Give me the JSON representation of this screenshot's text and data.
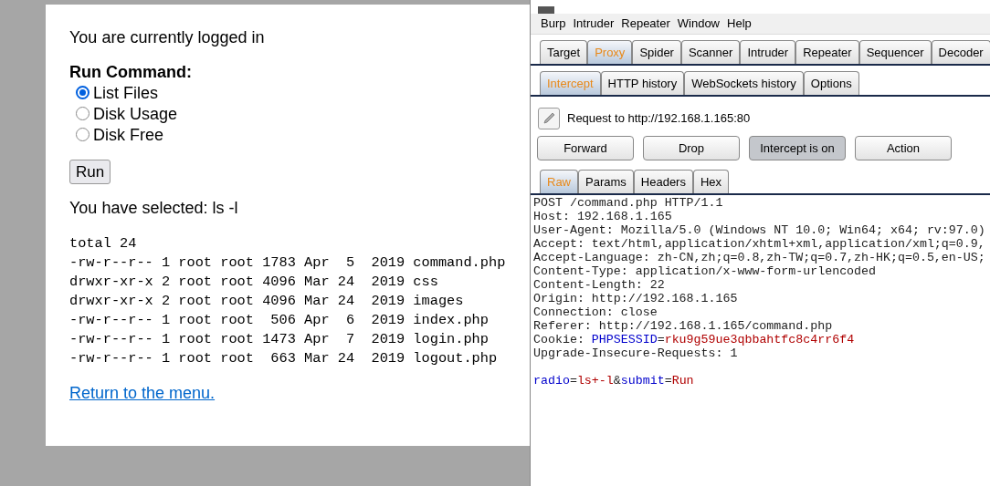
{
  "web_page": {
    "login_status": "You are currently logged in",
    "form_label": "Run Command:",
    "options": [
      {
        "label": "List Files",
        "checked": true
      },
      {
        "label": "Disk Usage",
        "checked": false
      },
      {
        "label": "Disk Free",
        "checked": false
      }
    ],
    "run_button": "Run",
    "selection": "You have selected: ls -l",
    "output_lines": [
      "total 24",
      "-rw-r--r-- 1 root root 1783 Apr  5  2019 command.php",
      "drwxr-xr-x 2 root root 4096 Mar 24  2019 css",
      "drwxr-xr-x 2 root root 4096 Mar 24  2019 images",
      "-rw-r--r-- 1 root root  506 Apr  6  2019 index.php",
      "-rw-r--r-- 1 root root 1473 Apr  7  2019 login.php",
      "-rw-r--r-- 1 root root  663 Mar 24  2019 logout.php"
    ],
    "return_link": "Return to the menu."
  },
  "burp": {
    "menu": [
      "Burp",
      "Intruder",
      "Repeater",
      "Window",
      "Help"
    ],
    "tabs": [
      {
        "label": "Target",
        "selected": false
      },
      {
        "label": "Proxy",
        "selected": true
      },
      {
        "label": "Spider",
        "selected": false
      },
      {
        "label": "Scanner",
        "selected": false
      },
      {
        "label": "Intruder",
        "selected": false
      },
      {
        "label": "Repeater",
        "selected": false
      },
      {
        "label": "Sequencer",
        "selected": false
      },
      {
        "label": "Decoder",
        "selected": false
      }
    ],
    "sub_tabs": [
      {
        "label": "Intercept",
        "selected": true
      },
      {
        "label": "HTTP history",
        "selected": false
      },
      {
        "label": "WebSockets history",
        "selected": false
      },
      {
        "label": "Options",
        "selected": false
      }
    ],
    "request_target": "Request to http://192.168.1.165:80",
    "buttons": [
      {
        "label": "Forward",
        "pressed": false
      },
      {
        "label": "Drop",
        "pressed": false
      },
      {
        "label": "Intercept is on",
        "pressed": true
      },
      {
        "label": "Action",
        "pressed": false
      }
    ],
    "view_tabs": [
      {
        "label": "Raw",
        "selected": true
      },
      {
        "label": "Params",
        "selected": false
      },
      {
        "label": "Headers",
        "selected": false
      },
      {
        "label": "Hex",
        "selected": false
      }
    ],
    "header_lines": [
      [
        {
          "text": "POST /command.php HTTP/1.1",
          "kind": "plain"
        }
      ],
      [
        {
          "text": "Host: 192.168.1.165",
          "kind": "plain"
        }
      ],
      [
        {
          "text": "User-Agent: Mozilla/5.0 (Windows NT 10.0; Win64; x64; rv:97.0)",
          "kind": "plain"
        }
      ],
      [
        {
          "text": "Accept: text/html,application/xhtml+xml,application/xml;q=0.9,",
          "kind": "plain"
        }
      ],
      [
        {
          "text": "Accept-Language: zh-CN,zh;q=0.8,zh-TW;q=0.7,zh-HK;q=0.5,en-US;",
          "kind": "plain"
        }
      ],
      [
        {
          "text": "Content-Type: application/x-www-form-urlencoded",
          "kind": "plain"
        }
      ],
      [
        {
          "text": "Content-Length: 22",
          "kind": "plain"
        }
      ],
      [
        {
          "text": "Origin: http://192.168.1.165",
          "kind": "plain"
        }
      ],
      [
        {
          "text": "Connection: close",
          "kind": "plain"
        }
      ],
      [
        {
          "text": "Referer: http://192.168.1.165/command.php",
          "kind": "plain"
        }
      ],
      [
        {
          "text": "Cookie: ",
          "kind": "plain"
        },
        {
          "text": "PHPSESSID",
          "kind": "name"
        },
        {
          "text": "=",
          "kind": "plain"
        },
        {
          "text": "rku9g59ue3qbbahtfc8c4rr6f4",
          "kind": "value"
        }
      ],
      [
        {
          "text": "Upgrade-Insecure-Requests: 1",
          "kind": "plain"
        }
      ]
    ],
    "body_lines": [
      [
        {
          "text": "radio",
          "kind": "name"
        },
        {
          "text": "=",
          "kind": "plain"
        },
        {
          "text": "ls+-l",
          "kind": "value"
        },
        {
          "text": "&",
          "kind": "plain"
        },
        {
          "text": "submit",
          "kind": "name"
        },
        {
          "text": "=",
          "kind": "plain"
        },
        {
          "text": "Run",
          "kind": "value"
        }
      ]
    ]
  }
}
